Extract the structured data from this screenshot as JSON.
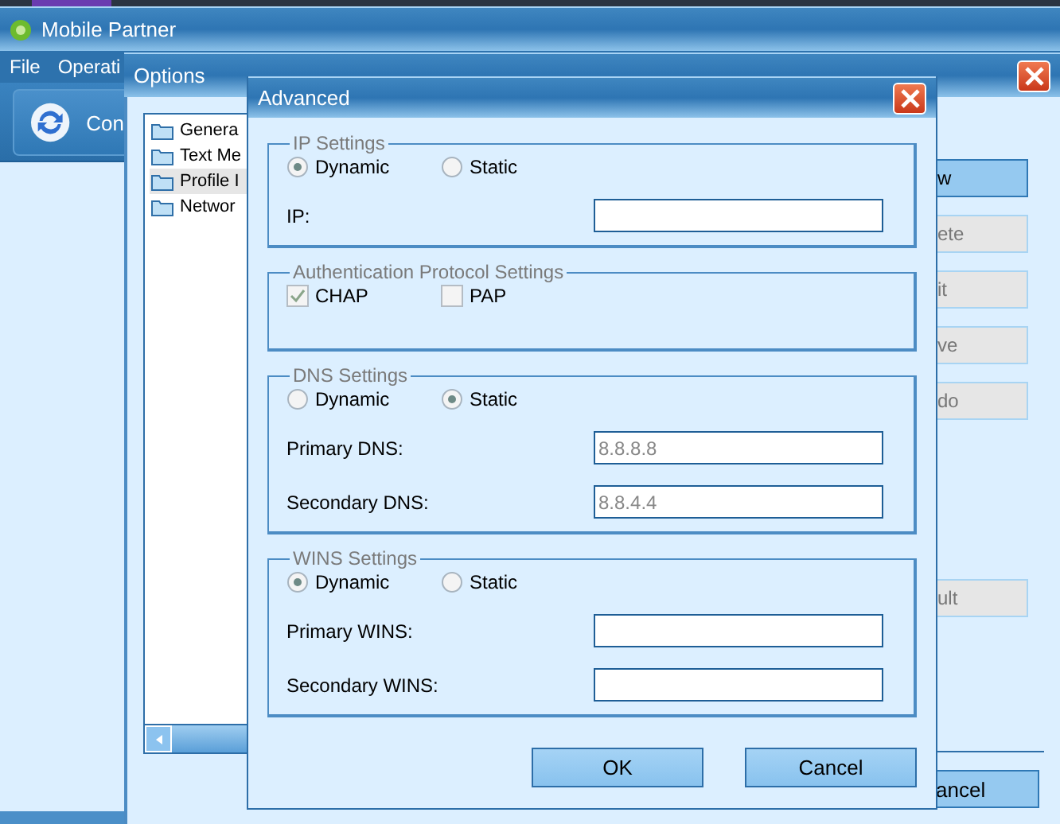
{
  "main_window": {
    "title": "Mobile Partner",
    "menu": [
      "File",
      "Operati"
    ],
    "toolbar": [
      {
        "label": "Con"
      }
    ]
  },
  "options_window": {
    "title": "Options",
    "tree": [
      {
        "label": "Genera",
        "selected": false
      },
      {
        "label": "Text Me",
        "selected": false
      },
      {
        "label": "Profile I",
        "selected": true
      },
      {
        "label": "Networ",
        "selected": false
      }
    ],
    "buttons": [
      {
        "label": "w",
        "disabled": false
      },
      {
        "label": "ete",
        "disabled": true
      },
      {
        "label": "it",
        "disabled": true
      },
      {
        "label": "ve",
        "disabled": true
      },
      {
        "label": "do",
        "disabled": true
      },
      {
        "label": "ult",
        "disabled": true
      }
    ],
    "footer_buttons": [
      "ancel"
    ]
  },
  "advanced_window": {
    "title": "Advanced",
    "groups": [
      {
        "title": "IP Settings",
        "kind": "radio",
        "options": [
          {
            "label": "Dynamic",
            "selected": true
          },
          {
            "label": "Static",
            "selected": false
          }
        ],
        "fields": [
          {
            "label": "IP:"
          }
        ]
      },
      {
        "title": "Authentication Protocol Settings",
        "kind": "checkbox",
        "options": [
          {
            "label": "CHAP",
            "checked": true
          },
          {
            "label": "PAP",
            "checked": false
          }
        ]
      },
      {
        "title": "DNS Settings",
        "kind": "radio",
        "options": [
          {
            "label": "Dynamic",
            "selected": false
          },
          {
            "label": "Static",
            "selected": true
          }
        ],
        "fields": [
          {
            "label": "Primary DNS:",
            "value": "8.8.8.8"
          },
          {
            "label": "Secondary DNS:",
            "value": "8.8.4.4"
          }
        ]
      },
      {
        "title": "WINS Settings",
        "kind": "radio",
        "options": [
          {
            "label": "Dynamic",
            "selected": true
          },
          {
            "label": "Static",
            "selected": false
          }
        ],
        "fields": [
          {
            "label": "Primary WINS:"
          },
          {
            "label": "Secondary WINS:"
          }
        ]
      }
    ],
    "buttons": [
      "OK",
      "Cancel"
    ]
  }
}
